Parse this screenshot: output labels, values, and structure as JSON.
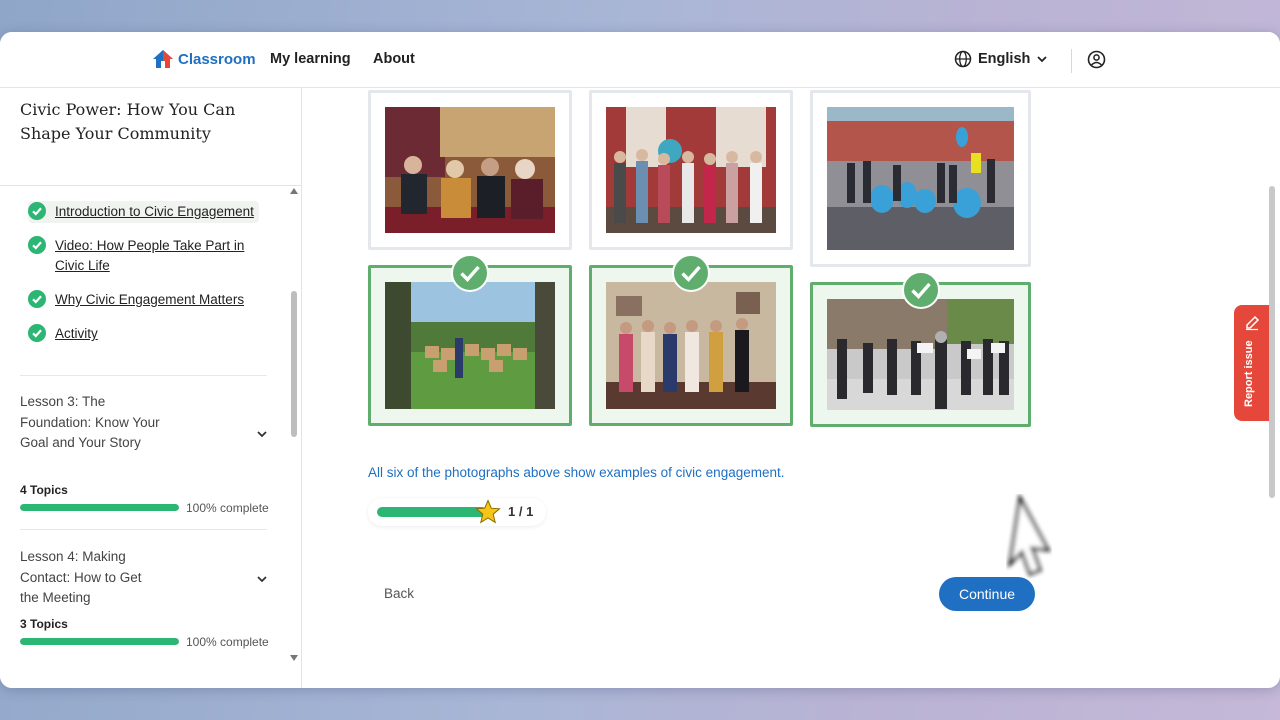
{
  "header": {
    "logo_text": "Classroom",
    "nav": [
      "My learning",
      "About"
    ],
    "language": "English",
    "icons": {
      "logo": "house-icon",
      "language": "globe-icon",
      "dropdown": "chevron-down-icon",
      "account": "user-circle-icon"
    }
  },
  "sidebar": {
    "course_title": "Civic Power: How You Can Shape Your Community",
    "topics": [
      {
        "label": "Introduction to Civic Engagement",
        "status": "complete",
        "active": true
      },
      {
        "label": "Video: How People Take Part in Civic Life",
        "status": "complete",
        "active": false
      },
      {
        "label": "Why Civic Engagement Matters",
        "status": "complete",
        "active": false
      },
      {
        "label": "Activity",
        "status": "complete",
        "active": false
      }
    ],
    "lessons": [
      {
        "title": "Lesson 3: The Foundation: Know Your Goal and Your Story",
        "topics": "4 Topics",
        "progress": 1.0,
        "progress_label": "100% complete"
      },
      {
        "title": "Lesson 4: Making Contact: How to Get the Meeting",
        "topics": "3 Topics",
        "progress": 1.0,
        "progress_label": "100% complete"
      }
    ]
  },
  "activity": {
    "photos": [
      {
        "subject": "panel discussion",
        "correct": false
      },
      {
        "subject": "group portrait",
        "correct": false
      },
      {
        "subject": "park cleanup",
        "correct": false
      },
      {
        "subject": "outdoor food distribution",
        "correct": true
      },
      {
        "subject": "office meeting group",
        "correct": true
      },
      {
        "subject": "street rally with signs",
        "correct": true
      }
    ],
    "feedback": "All six of the photographs above show examples of civic engagement.",
    "score": {
      "fraction": 1.0,
      "label": "1 / 1"
    }
  },
  "buttons": {
    "back": "Back",
    "continue": "Continue"
  },
  "report_issue": "Report issue",
  "colors": {
    "accent": "#1f6fc2",
    "success": "#2bb673",
    "report": "#e5483b",
    "correct_border": "#5fae6e"
  }
}
